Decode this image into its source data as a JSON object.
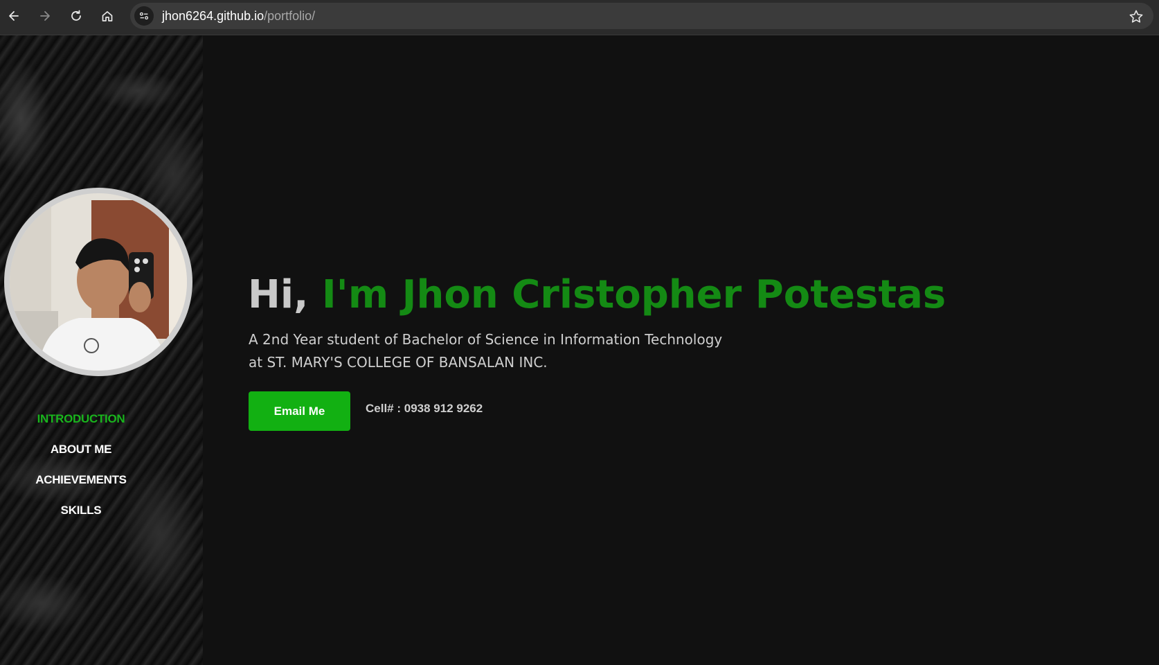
{
  "browser": {
    "url_domain": "jhon6264.github.io",
    "url_path": "/portfolio/",
    "icons": [
      "back-icon",
      "forward-icon",
      "reload-icon",
      "home-icon",
      "site-info-icon",
      "bookmark-star-icon"
    ]
  },
  "sidebar": {
    "items": [
      {
        "label": "INTRODUCTION",
        "active": true
      },
      {
        "label": "ABOUT ME",
        "active": false
      },
      {
        "label": "ACHIEVEMENTS",
        "active": false
      },
      {
        "label": "SKILLS",
        "active": false
      }
    ]
  },
  "hero": {
    "greeting": "Hi, ",
    "name": "I'm Jhon Cristopher Potestas",
    "subtitle_line1": "A 2nd Year student of Bachelor of Science in Information Technology",
    "subtitle_line2": "at ST. MARY'S COLLEGE OF BANSALAN INC.",
    "email_button": "Email Me",
    "phone": "Cell# : 0938 912 9262"
  },
  "colors": {
    "accent": "#12b012",
    "name": "#148a14",
    "background": "#111111"
  }
}
